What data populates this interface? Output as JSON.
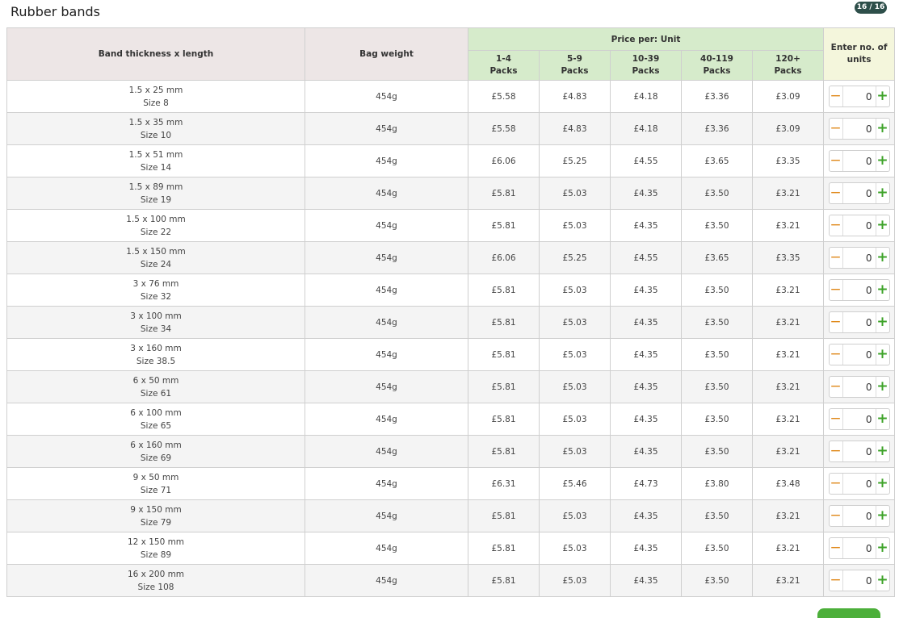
{
  "title": "Rubber bands",
  "page_counter": "16 / 16",
  "headers": {
    "band": "Band thickness x length",
    "weight": "Bag weight",
    "price_per": "Price per:  Unit",
    "units": [
      "Enter no. of",
      "units"
    ],
    "tiers": [
      {
        "qty": "1-4",
        "unit": "Packs"
      },
      {
        "qty": "5-9",
        "unit": "Packs"
      },
      {
        "qty": "10-39",
        "unit": "Packs"
      },
      {
        "qty": "40-119",
        "unit": "Packs"
      },
      {
        "qty": "120+",
        "unit": "Packs"
      }
    ]
  },
  "rows": [
    {
      "dims": "1.5 x 25 mm",
      "size": "Size 8",
      "weight": "454g",
      "prices": [
        "£5.58",
        "£4.83",
        "£4.18",
        "£3.36",
        "£3.09"
      ],
      "qty": "0"
    },
    {
      "dims": "1.5 x 35 mm",
      "size": "Size 10",
      "weight": "454g",
      "prices": [
        "£5.58",
        "£4.83",
        "£4.18",
        "£3.36",
        "£3.09"
      ],
      "qty": "0"
    },
    {
      "dims": "1.5 x 51 mm",
      "size": "Size 14",
      "weight": "454g",
      "prices": [
        "£6.06",
        "£5.25",
        "£4.55",
        "£3.65",
        "£3.35"
      ],
      "qty": "0"
    },
    {
      "dims": "1.5 x 89 mm",
      "size": "Size 19",
      "weight": "454g",
      "prices": [
        "£5.81",
        "£5.03",
        "£4.35",
        "£3.50",
        "£3.21"
      ],
      "qty": "0"
    },
    {
      "dims": "1.5 x 100 mm",
      "size": "Size 22",
      "weight": "454g",
      "prices": [
        "£5.81",
        "£5.03",
        "£4.35",
        "£3.50",
        "£3.21"
      ],
      "qty": "0"
    },
    {
      "dims": "1.5 x 150 mm",
      "size": "Size 24",
      "weight": "454g",
      "prices": [
        "£6.06",
        "£5.25",
        "£4.55",
        "£3.65",
        "£3.35"
      ],
      "qty": "0"
    },
    {
      "dims": "3 x 76 mm",
      "size": "Size 32",
      "weight": "454g",
      "prices": [
        "£5.81",
        "£5.03",
        "£4.35",
        "£3.50",
        "£3.21"
      ],
      "qty": "0"
    },
    {
      "dims": "3 x 100 mm",
      "size": "Size 34",
      "weight": "454g",
      "prices": [
        "£5.81",
        "£5.03",
        "£4.35",
        "£3.50",
        "£3.21"
      ],
      "qty": "0"
    },
    {
      "dims": "3 x 160 mm",
      "size": "Size 38.5",
      "weight": "454g",
      "prices": [
        "£5.81",
        "£5.03",
        "£4.35",
        "£3.50",
        "£3.21"
      ],
      "qty": "0"
    },
    {
      "dims": "6 x 50 mm",
      "size": "Size 61",
      "weight": "454g",
      "prices": [
        "£5.81",
        "£5.03",
        "£4.35",
        "£3.50",
        "£3.21"
      ],
      "qty": "0"
    },
    {
      "dims": "6 x 100 mm",
      "size": "Size 65",
      "weight": "454g",
      "prices": [
        "£5.81",
        "£5.03",
        "£4.35",
        "£3.50",
        "£3.21"
      ],
      "qty": "0"
    },
    {
      "dims": "6 x 160 mm",
      "size": "Size 69",
      "weight": "454g",
      "prices": [
        "£5.81",
        "£5.03",
        "£4.35",
        "£3.50",
        "£3.21"
      ],
      "qty": "0"
    },
    {
      "dims": "9 x 50 mm",
      "size": "Size 71",
      "weight": "454g",
      "prices": [
        "£6.31",
        "£5.46",
        "£4.73",
        "£3.80",
        "£3.48"
      ],
      "qty": "0"
    },
    {
      "dims": "9 x 150 mm",
      "size": "Size 79",
      "weight": "454g",
      "prices": [
        "£5.81",
        "£5.03",
        "£4.35",
        "£3.50",
        "£3.21"
      ],
      "qty": "0"
    },
    {
      "dims": "12 x 150 mm",
      "size": "Size 89",
      "weight": "454g",
      "prices": [
        "£5.81",
        "£5.03",
        "£4.35",
        "£3.50",
        "£3.21"
      ],
      "qty": "0"
    },
    {
      "dims": "16 x 200 mm",
      "size": "Size 108",
      "weight": "454g",
      "prices": [
        "£5.81",
        "£5.03",
        "£4.35",
        "£3.50",
        "£3.21"
      ],
      "qty": "0"
    }
  ],
  "icons": {
    "decrement": "minus-icon",
    "increment": "plus-icon"
  },
  "colors": {
    "header_price": "#d6ebcb",
    "header_plain": "#ede6e6",
    "header_units": "#f4f6dc",
    "badge": "#2e4f4a",
    "minus": "#e0891a",
    "plus": "#3ea329"
  }
}
